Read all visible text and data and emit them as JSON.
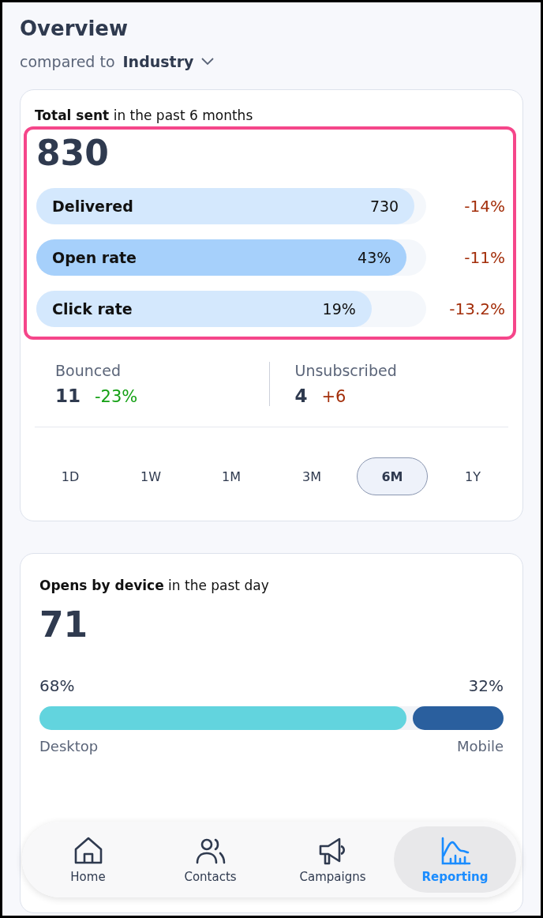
{
  "header": {
    "title": "Overview",
    "compare_label": "compared to",
    "compare_value": "Industry"
  },
  "total_card": {
    "title": "**Total sent** in the past 6 months",
    "total": "830",
    "highlighted": true,
    "metrics": [
      {
        "label": "Delivered",
        "value": "730",
        "level": 0.97,
        "change": "-14%",
        "selected": false
      },
      {
        "label": "Open rate",
        "value": "43%",
        "level": 0.95,
        "change": "-11%",
        "selected": true
      },
      {
        "label": "Click rate",
        "value": "19%",
        "level": 0.86,
        "change": "-13.2%",
        "selected": false
      }
    ],
    "stats": [
      {
        "label": "Bounced",
        "value": "11",
        "change": "-23%",
        "color": "#14a014"
      },
      {
        "label": "Unsubscribed",
        "value": "4",
        "change": "+6",
        "color": "#a32e0a"
      }
    ],
    "ranges": [
      {
        "label": "1D",
        "selected": false
      },
      {
        "label": "1W",
        "selected": false
      },
      {
        "label": "1M",
        "selected": false
      },
      {
        "label": "3M",
        "selected": false
      },
      {
        "label": "6M",
        "selected": true
      },
      {
        "label": "1Y",
        "selected": false
      }
    ]
  },
  "device_card": {
    "title": "**Opens by device** in the past day",
    "total": "71",
    "level": 0.79,
    "segments": [
      {
        "share": "68%",
        "label": "Desktop"
      },
      {
        "share": "32%",
        "label": "Mobile"
      }
    ]
  },
  "nav": [
    {
      "label": "Home",
      "selected": false
    },
    {
      "label": "Contacts",
      "selected": false
    },
    {
      "label": "Campaigns",
      "selected": false
    },
    {
      "label": "Reporting",
      "selected": true
    }
  ]
}
